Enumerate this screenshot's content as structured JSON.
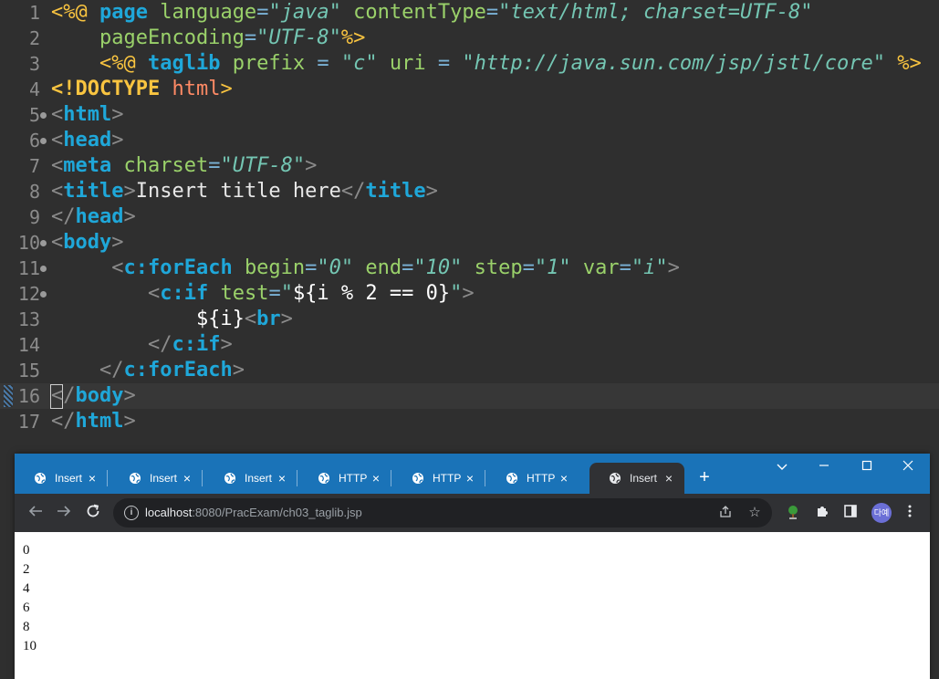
{
  "editor": {
    "current_line": 16,
    "lines": [
      {
        "n": "1",
        "fold": false,
        "tokens": [
          [
            "<%@ ",
            "br"
          ],
          [
            "page ",
            "kw"
          ],
          [
            "language",
            "at"
          ],
          [
            "=",
            "eq"
          ],
          [
            "\"java\"",
            "sv"
          ],
          [
            " contentType",
            "at"
          ],
          [
            "=",
            "eq"
          ],
          [
            "\"text/html; charset=UTF-8\"",
            "sv"
          ]
        ]
      },
      {
        "n": "2",
        "fold": false,
        "tokens": [
          [
            "    pageEncoding",
            "at"
          ],
          [
            "=",
            "eq"
          ],
          [
            "\"UTF-8\"",
            "sv"
          ],
          [
            "%>",
            "br"
          ]
        ]
      },
      {
        "n": "3",
        "fold": false,
        "tokens": [
          [
            "    <%@ ",
            "br"
          ],
          [
            "taglib ",
            "kw"
          ],
          [
            "prefix",
            "at"
          ],
          [
            " = ",
            "eq"
          ],
          [
            "\"c\"",
            "sv"
          ],
          [
            " uri",
            "at"
          ],
          [
            " = ",
            "eq"
          ],
          [
            "\"http://java.sun.com/jsp/jstl/core\"",
            "sv"
          ],
          [
            " %>",
            "br"
          ]
        ]
      },
      {
        "n": "4",
        "fold": false,
        "tokens": [
          [
            "<!DOCTYPE ",
            "doc"
          ],
          [
            "html",
            "dn"
          ],
          [
            ">",
            "br"
          ]
        ]
      },
      {
        "n": "5",
        "fold": true,
        "tokens": [
          [
            "<",
            "tg"
          ],
          [
            "html",
            "kw"
          ],
          [
            ">",
            "tg"
          ]
        ]
      },
      {
        "n": "6",
        "fold": true,
        "tokens": [
          [
            "<",
            "tg"
          ],
          [
            "head",
            "kw"
          ],
          [
            ">",
            "tg"
          ]
        ]
      },
      {
        "n": "7",
        "fold": false,
        "tokens": [
          [
            "<",
            "tg"
          ],
          [
            "meta ",
            "kw"
          ],
          [
            "charset",
            "at"
          ],
          [
            "=",
            "eq"
          ],
          [
            "\"UTF-8\"",
            "sv"
          ],
          [
            ">",
            "tg"
          ]
        ]
      },
      {
        "n": "8",
        "fold": false,
        "tokens": [
          [
            "<",
            "tg"
          ],
          [
            "title",
            "kw"
          ],
          [
            ">",
            "tg"
          ],
          [
            "Insert title here",
            "tx"
          ],
          [
            "</",
            "tg"
          ],
          [
            "title",
            "kw"
          ],
          [
            ">",
            "tg"
          ]
        ]
      },
      {
        "n": "9",
        "fold": false,
        "tokens": [
          [
            "</",
            "tg"
          ],
          [
            "head",
            "kw"
          ],
          [
            ">",
            "tg"
          ]
        ]
      },
      {
        "n": "10",
        "fold": true,
        "tokens": [
          [
            "<",
            "tg"
          ],
          [
            "body",
            "kw"
          ],
          [
            ">",
            "tg"
          ]
        ]
      },
      {
        "n": "11",
        "fold": true,
        "tokens": [
          [
            "     <",
            "tg"
          ],
          [
            "c:forEach ",
            "kw"
          ],
          [
            "begin",
            "at"
          ],
          [
            "=",
            "eq"
          ],
          [
            "\"0\"",
            "sv"
          ],
          [
            " end",
            "at"
          ],
          [
            "=",
            "eq"
          ],
          [
            "\"10\"",
            "sv"
          ],
          [
            " step",
            "at"
          ],
          [
            "=",
            "eq"
          ],
          [
            "\"1\"",
            "sv"
          ],
          [
            " var",
            "at"
          ],
          [
            "=",
            "eq"
          ],
          [
            "\"i\"",
            "sv"
          ],
          [
            ">",
            "tg"
          ]
        ]
      },
      {
        "n": "12",
        "fold": true,
        "tokens": [
          [
            "        <",
            "tg"
          ],
          [
            "c:if ",
            "kw"
          ],
          [
            "test",
            "at"
          ],
          [
            "=",
            "eq"
          ],
          [
            "\"",
            "sv"
          ],
          [
            "${i % 2 == 0}",
            "ex"
          ],
          [
            "\"",
            "sv"
          ],
          [
            ">",
            "tg"
          ]
        ]
      },
      {
        "n": "13",
        "fold": false,
        "tokens": [
          [
            "            ${i}",
            "ex"
          ],
          [
            "<",
            "tg"
          ],
          [
            "br",
            "kw"
          ],
          [
            ">",
            "tg"
          ]
        ]
      },
      {
        "n": "14",
        "fold": false,
        "tokens": [
          [
            "        </",
            "tg"
          ],
          [
            "c:if",
            "kw"
          ],
          [
            ">",
            "tg"
          ]
        ]
      },
      {
        "n": "15",
        "fold": false,
        "tokens": [
          [
            "    </",
            "tg"
          ],
          [
            "c:forEach",
            "kw"
          ],
          [
            ">",
            "tg"
          ]
        ]
      },
      {
        "n": "16",
        "fold": false,
        "tokens": [
          [
            "</",
            "tg"
          ],
          [
            "body",
            "kw"
          ],
          [
            ">",
            "tg"
          ]
        ]
      },
      {
        "n": "17",
        "fold": false,
        "tokens": [
          [
            "</",
            "tg"
          ],
          [
            "html",
            "kw"
          ],
          [
            ">",
            "tg"
          ]
        ]
      }
    ]
  },
  "browser": {
    "tabs": [
      {
        "label": "Insert",
        "active": false
      },
      {
        "label": "Insert",
        "active": false
      },
      {
        "label": "Insert",
        "active": false
      },
      {
        "label": "HTTP",
        "active": false
      },
      {
        "label": "HTTP",
        "active": false
      },
      {
        "label": "HTTP",
        "active": false
      },
      {
        "label": "Insert",
        "active": true
      }
    ],
    "tab_close_glyph": "×",
    "new_tab_glyph": "+",
    "url_host": "localhost",
    "url_rest": ":8080/PracExam/ch03_taglib.jsp",
    "avatar_text": "다예",
    "output": [
      "0",
      "2",
      "4",
      "6",
      "8",
      "10"
    ]
  }
}
